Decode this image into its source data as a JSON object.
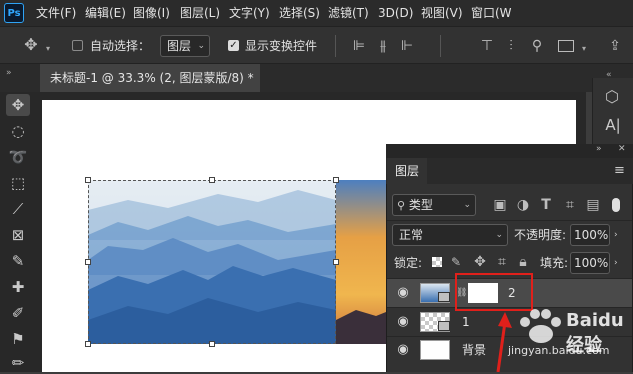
{
  "app": {
    "logo": "Ps"
  },
  "menu": [
    "文件(F)",
    "编辑(E)",
    "图像(I)",
    "图层(L)",
    "文字(Y)",
    "选择(S)",
    "滤镜(T)",
    "3D(D)",
    "视图(V)",
    "窗口(W"
  ],
  "options_bar": {
    "auto_select_label": "自动选择：",
    "auto_select_checked": false,
    "auto_select_target": "图层",
    "show_transform_label": "显示变换控件",
    "show_transform_checked": true,
    "icons": [
      "move-tool-icon",
      "align-left-icon",
      "align-center-icon",
      "align-right-icon",
      "align-top-icon",
      "distribute-icon",
      "search-icon",
      "workspace-icon",
      "share-icon"
    ]
  },
  "document_tab": {
    "title": "未标题-1 @ 33.3% (2, 图层蒙版/8) *",
    "close": "×"
  },
  "panel": {
    "title": "图层",
    "filter_label": "类型",
    "blend_mode": "正常",
    "opacity_label": "不透明度:",
    "opacity_value": "100%",
    "lock_label": "锁定:",
    "fill_label": "填充:",
    "fill_value": "100%"
  },
  "layers": [
    {
      "name": "2",
      "selected": true,
      "has_mask": true
    },
    {
      "name": "1",
      "selected": false,
      "has_mask": false
    },
    {
      "name": "背景",
      "selected": false,
      "locked": true
    }
  ],
  "watermark": {
    "brand": "Baidu 经验",
    "url": "jingyan.baidu.com"
  },
  "colors": {
    "menubar": "#2b2b2b",
    "panel": "#323232",
    "selected_row": "#4a4a4a",
    "highlight_red": "#e0201b",
    "ps_blue": "#31a8ff"
  }
}
